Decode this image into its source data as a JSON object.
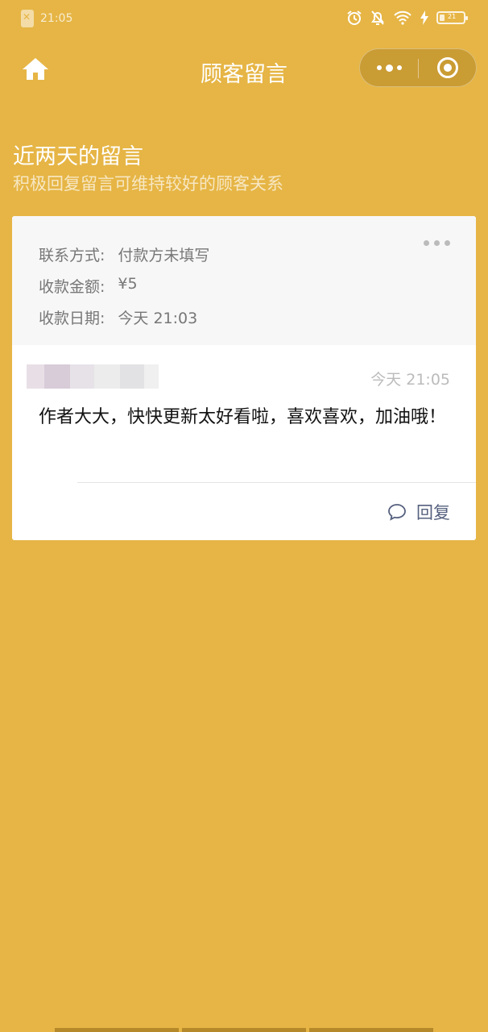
{
  "status_bar": {
    "time": "21:05",
    "battery": "21",
    "icons": [
      "sim-off-icon",
      "alarm-icon",
      "mute-bell-icon",
      "wifi-icon",
      "charging-icon",
      "battery-icon"
    ]
  },
  "navbar": {
    "title": "顾客留言",
    "home_icon": "home-icon",
    "more_icon": "more-dots-icon",
    "close_icon": "target-close-icon"
  },
  "header": {
    "title": "近两天的留言",
    "subtitle": "积极回复留言可维持较好的顾客关系"
  },
  "message_card": {
    "contact_label": "联系方式:",
    "contact_value": "付款方未填写",
    "amount_label": "收款金额:",
    "amount_value": "¥5",
    "date_label": "收款日期:",
    "date_value": "今天 21:03",
    "message_time": "今天 21:05",
    "message_text": "作者大大，快快更新太好看啦，喜欢喜欢，加油哦！",
    "reply_label": "回复"
  },
  "colors": {
    "background": "#E6B545",
    "card": "#FFFFFF",
    "info_bg": "#F7F7F7",
    "reply": "#56617F"
  }
}
